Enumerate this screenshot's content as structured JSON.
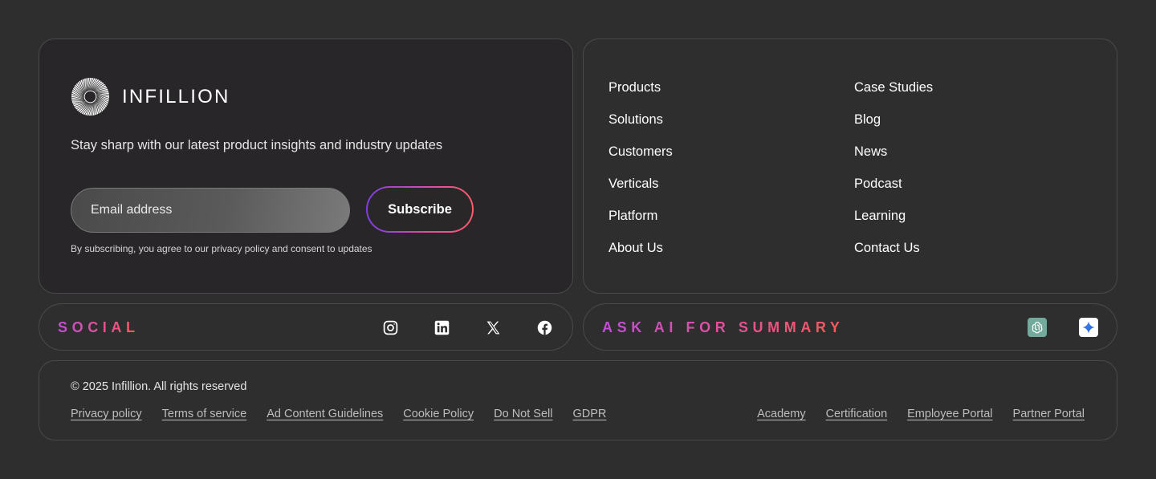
{
  "brand": {
    "name": "INFILLION",
    "logo_icon": "infillion-radial-logo-icon"
  },
  "newsletter": {
    "tagline": "Stay sharp with our latest product insights and industry updates",
    "email_placeholder": "Email address",
    "subscribe_label": "Subscribe",
    "consent_text": "By subscribing, you agree to our privacy policy and consent to updates",
    "button_gradient": [
      "#7b3fe4",
      "#d64fa8",
      "#ff5a6a"
    ]
  },
  "nav": {
    "left": [
      "Products",
      "Solutions",
      "Customers",
      "Verticals",
      "Platform",
      "About Us"
    ],
    "right": [
      "Case Studies",
      "Blog",
      "News",
      "Podcast",
      "Learning",
      "Contact Us"
    ]
  },
  "social": {
    "label": "SOCIAL",
    "icons": [
      "instagram-icon",
      "linkedin-icon",
      "x-icon",
      "facebook-icon"
    ]
  },
  "ask_ai": {
    "label": "ASK AI FOR SUMMARY",
    "icons": [
      "chatgpt-icon",
      "gemini-icon"
    ]
  },
  "footer": {
    "copyright": "© 2025 Infillion. All rights reserved",
    "legal_links": [
      "Privacy policy",
      "Terms of service",
      "Ad Content Guidelines",
      "Cookie Policy",
      "Do Not Sell",
      "GDPR"
    ],
    "portal_links": [
      "Academy",
      "Certification",
      "Employee Portal",
      "Partner Portal"
    ]
  },
  "colors": {
    "background": "#2e2e2e",
    "card_border": "#4a4a4a",
    "accent_pink": "#e9508f",
    "accent_purple": "#c04fd8"
  }
}
